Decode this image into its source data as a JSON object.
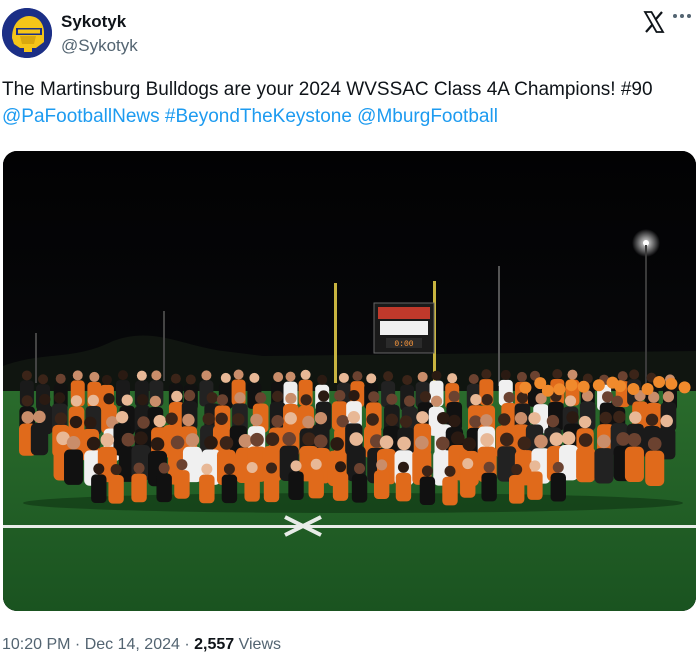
{
  "author": {
    "display_name": "Sykotyk",
    "handle": "@Sykotyk",
    "avatar_icon": "helmet-avatar-icon"
  },
  "tweet": {
    "text_main": "The Martinsburg Bulldogs are your 2024 WVSSAC Class 4A Champions! #90 ",
    "links": [
      "@PaFootballNews",
      "#BeyondTheKeystone",
      "@MburgFootball"
    ],
    "image_description": "Team photo of the Martinsburg Bulldogs football team, cheerleaders and coaches celebrating on the field at night in front of the scoreboard"
  },
  "meta": {
    "time": "10:20 PM",
    "separator1": " · ",
    "date": "Dec 14, 2024",
    "separator2": " · ",
    "views_count": "2,557",
    "views_label": " Views"
  },
  "colors": {
    "link": "#1d9bf0",
    "text": "#0f1419",
    "secondary": "#536471",
    "jersey": "#e06a1b",
    "field": "#1c5a23"
  }
}
